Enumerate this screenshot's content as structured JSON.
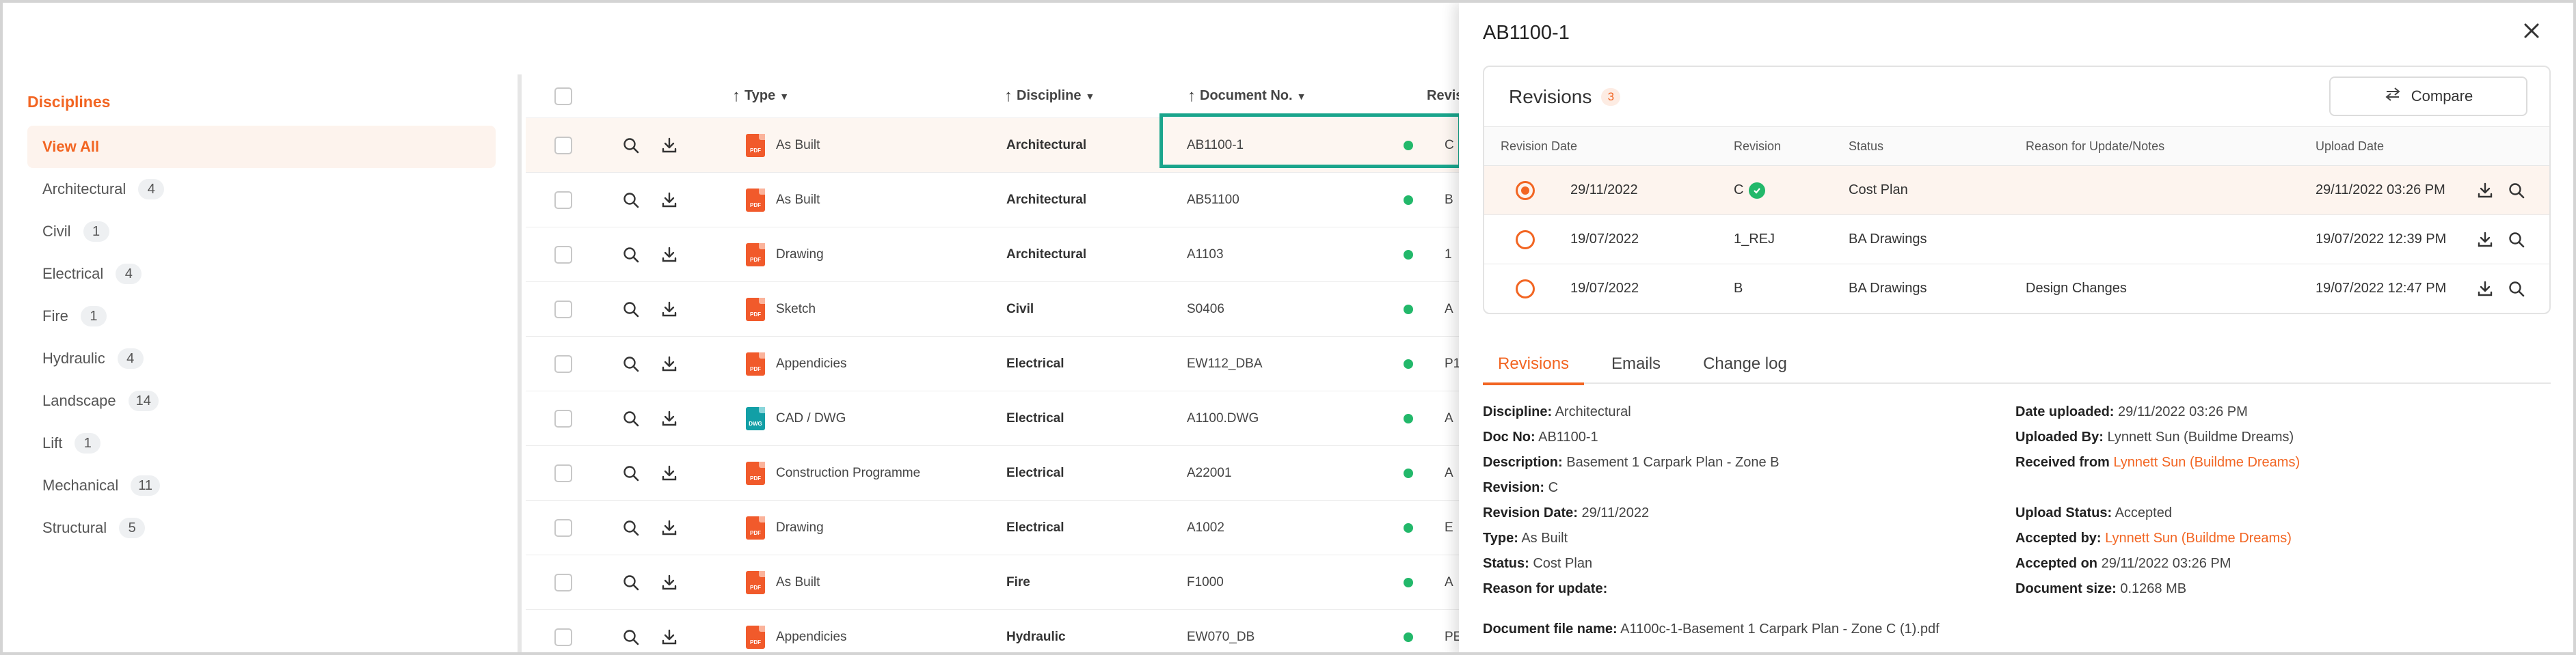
{
  "sidebar": {
    "title": "Disciplines",
    "items": [
      {
        "label": "View All",
        "count": null
      },
      {
        "label": "Architectural",
        "count": "4"
      },
      {
        "label": "Civil",
        "count": "1"
      },
      {
        "label": "Electrical",
        "count": "4"
      },
      {
        "label": "Fire",
        "count": "1"
      },
      {
        "label": "Hydraulic",
        "count": "4"
      },
      {
        "label": "Landscape",
        "count": "14"
      },
      {
        "label": "Lift",
        "count": "1"
      },
      {
        "label": "Mechanical",
        "count": "11"
      },
      {
        "label": "Structural",
        "count": "5"
      }
    ]
  },
  "table": {
    "headers": {
      "type": "Type",
      "discipline": "Discipline",
      "doc_no": "Document No.",
      "revision": "Revis"
    },
    "rows": [
      {
        "type": "As Built",
        "icon": "PDF",
        "discipline": "Architectural",
        "doc_no": "AB1100-1",
        "rev": "C"
      },
      {
        "type": "As Built",
        "icon": "PDF",
        "discipline": "Architectural",
        "doc_no": "AB51100",
        "rev": "B"
      },
      {
        "type": "Drawing",
        "icon": "PDF",
        "discipline": "Architectural",
        "doc_no": "A1103",
        "rev": "1"
      },
      {
        "type": "Sketch",
        "icon": "PDF",
        "discipline": "Civil",
        "doc_no": "S0406",
        "rev": "A"
      },
      {
        "type": "Appendicies",
        "icon": "PDF",
        "discipline": "Electrical",
        "doc_no": "EW112_DBA",
        "rev": "P1"
      },
      {
        "type": "CAD / DWG",
        "icon": "DWG",
        "discipline": "Electrical",
        "doc_no": "A1100.DWG",
        "rev": "A"
      },
      {
        "type": "Construction Programme",
        "icon": "PDF",
        "discipline": "Electrical",
        "doc_no": "A22001",
        "rev": "A"
      },
      {
        "type": "Drawing",
        "icon": "PDF",
        "discipline": "Electrical",
        "doc_no": "A1002",
        "rev": "E"
      },
      {
        "type": "As Built",
        "icon": "PDF",
        "discipline": "Fire",
        "doc_no": "F1000",
        "rev": "A"
      },
      {
        "type": "Appendicies",
        "icon": "PDF",
        "discipline": "Hydraulic",
        "doc_no": "EW070_DB",
        "rev": "PE"
      }
    ]
  },
  "panel": {
    "title": "AB1100-1",
    "revisions_title": "Revisions",
    "revisions_count": "3",
    "compare_label": "Compare",
    "columns": {
      "date": "Revision Date",
      "revision": "Revision",
      "status": "Status",
      "reason": "Reason for Update/Notes",
      "upload": "Upload Date"
    },
    "revisions": [
      {
        "date": "29/11/2022",
        "revision": "C",
        "status": "Cost Plan",
        "reason": "",
        "upload": "29/11/2022 03:26 PM"
      },
      {
        "date": "19/07/2022",
        "revision": "1_REJ",
        "status": "BA Drawings",
        "reason": "",
        "upload": "19/07/2022 12:39 PM"
      },
      {
        "date": "19/07/2022",
        "revision": "B",
        "status": "BA Drawings",
        "reason": "Design Changes",
        "upload": "19/07/2022 12:47 PM"
      }
    ],
    "tabs": [
      "Revisions",
      "Emails",
      "Change log"
    ],
    "details": {
      "discipline_label": "Discipline:",
      "discipline": "Architectural",
      "docno_label": "Doc No:",
      "docno": "AB1100-1",
      "description_label": "Description:",
      "description": "Basement 1 Carpark Plan - Zone B",
      "revision_label": "Revision:",
      "revision": "C",
      "revdate_label": "Revision Date:",
      "revdate": "29/11/2022",
      "type_label": "Type:",
      "type": "As Built",
      "status_label": "Status:",
      "status": "Cost Plan",
      "reason_label": "Reason for update:",
      "uploaded_label": "Date uploaded:",
      "uploaded": "29/11/2022 03:26 PM",
      "uploadedby_label": "Uploaded By:",
      "uploadedby": "Lynnett Sun (Buildme Dreams)",
      "received_label": "Received from",
      "received": "Lynnett Sun (Buildme Dreams)",
      "uploadstatus_label": "Upload Status:",
      "uploadstatus": "Accepted",
      "acceptedby_label": "Accepted by:",
      "acceptedby": "Lynnett Sun (Buildme Dreams)",
      "acceptedon_label": "Accepted on",
      "acceptedon": "29/11/2022 03:26 PM",
      "docsize_label": "Document size:",
      "docsize": "0.1268 MB",
      "filename_label": "Document file name:",
      "filename": "A1100c-1-Basement 1 Carpark Plan - Zone C (1).pdf"
    }
  },
  "colors": {
    "accent": "#f26522",
    "status_green": "#22b86a",
    "selection_border": "#1aa58c"
  }
}
